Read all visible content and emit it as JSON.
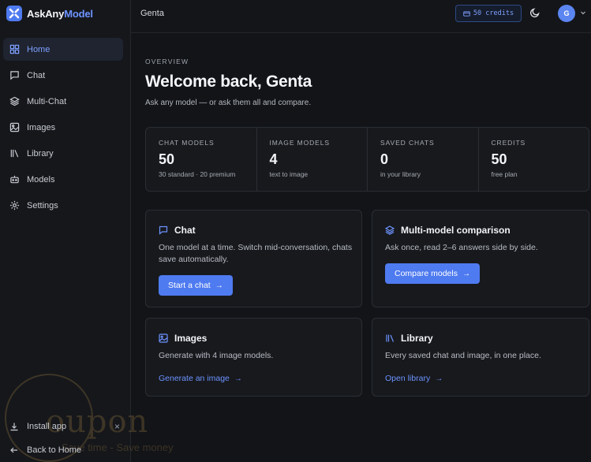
{
  "brand": {
    "name_part1": "AskAny",
    "name_part2": "Model"
  },
  "nav": {
    "items": [
      {
        "label": "Home",
        "icon": "home-icon",
        "active": true
      },
      {
        "label": "Chat",
        "icon": "chat-bubble-icon"
      },
      {
        "label": "Multi-Chat",
        "icon": "layers-icon"
      },
      {
        "label": "Images",
        "icon": "image-icon"
      },
      {
        "label": "Library",
        "icon": "library-icon"
      },
      {
        "label": "Models",
        "icon": "robot-icon"
      },
      {
        "label": "Settings",
        "icon": "gear-icon"
      }
    ]
  },
  "sidebar_footer": {
    "install_label": "Install app",
    "close_glyph": "×",
    "back_label": "Back to Home"
  },
  "watermark": {
    "text": "oupon",
    "sub": "Save time - Save money"
  },
  "topbar": {
    "user_name": "Genta",
    "credits_label": "50 credits",
    "avatar_initial": "G"
  },
  "overview": {
    "eyebrow": "OVERVIEW",
    "title": "Welcome back, Genta",
    "subtitle": "Ask any model — or ask them all and compare."
  },
  "stats": [
    {
      "label": "CHAT MODELS",
      "value": "50",
      "sub": "30 standard · 20 premium"
    },
    {
      "label": "IMAGE MODELS",
      "value": "4",
      "sub": "text to image"
    },
    {
      "label": "SAVED CHATS",
      "value": "0",
      "sub": "in your library"
    },
    {
      "label": "CREDITS",
      "value": "50",
      "sub": "free plan"
    }
  ],
  "cards": {
    "chat": {
      "title": "Chat",
      "desc": "One model at a time. Switch mid-conversation, chats save automatically.",
      "action": "Start a chat"
    },
    "multi": {
      "title": "Multi-model comparison",
      "desc": "Ask once, read 2–6 answers side by side.",
      "action": "Compare models"
    },
    "images": {
      "title": "Images",
      "desc": "Generate with 4 image models.",
      "action": "Generate an image"
    },
    "library": {
      "title": "Library",
      "desc": "Every saved chat and image, in one place.",
      "action": "Open library"
    }
  },
  "colors": {
    "accent": "#4f7bf0",
    "accent_text": "#6d93ff",
    "background": "#121418",
    "surface": "#17191d"
  }
}
